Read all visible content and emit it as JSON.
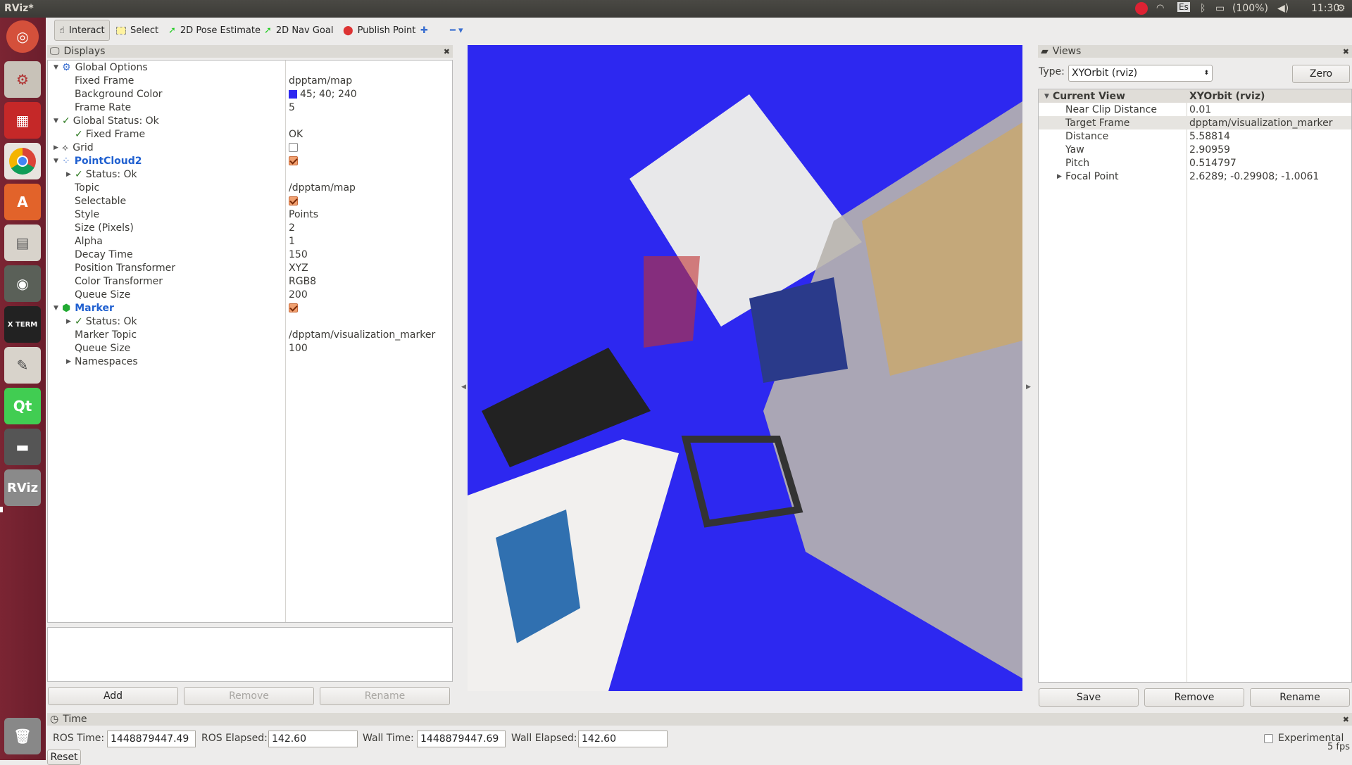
{
  "window_title": "RViz*",
  "top_indicators": {
    "keyboard": "Es",
    "battery": "(100%)",
    "clock": "11:30"
  },
  "colors": {
    "viewport_bg": "#2d28f0",
    "launcher": "#7b2533",
    "accent_blue": "#2060d0",
    "swatch": "#2d28f0"
  },
  "launcher_icons": [
    "ubuntu-dash-icon",
    "settings-icon",
    "app-red-icon",
    "chrome-icon",
    "software-center-icon",
    "files-icon",
    "eye-of-gnome-icon",
    "xterm-icon",
    "text-editor-icon",
    "qt-creator-icon",
    "terminal-icon",
    "rviz-icon",
    "trash-icon"
  ],
  "launcher_labels": {
    "xterm": "X TERM",
    "qt": "Qt",
    "rviz": "RViz"
  },
  "toolbar": {
    "interact": "Interact",
    "select": "Select",
    "pose": "2D Pose Estimate",
    "nav": "2D Nav Goal",
    "publish": "Publish Point"
  },
  "displays": {
    "title": "Displays",
    "rows": [
      {
        "label": "Global Options",
        "value": ""
      },
      {
        "label": "Fixed Frame",
        "value": "dpptam/map"
      },
      {
        "label": "Background Color",
        "value": "45; 40; 240"
      },
      {
        "label": "Frame Rate",
        "value": "5"
      },
      {
        "label": "Global Status: Ok",
        "value": ""
      },
      {
        "label": "Fixed Frame",
        "value": "OK"
      },
      {
        "label": "Grid",
        "value": ""
      },
      {
        "label": "PointCloud2",
        "value": ""
      },
      {
        "label": "Status: Ok",
        "value": ""
      },
      {
        "label": "Topic",
        "value": "/dpptam/map"
      },
      {
        "label": "Selectable",
        "value": ""
      },
      {
        "label": "Style",
        "value": "Points"
      },
      {
        "label": "Size (Pixels)",
        "value": "2"
      },
      {
        "label": "Alpha",
        "value": "1"
      },
      {
        "label": "Decay Time",
        "value": "150"
      },
      {
        "label": "Position Transformer",
        "value": "XYZ"
      },
      {
        "label": "Color Transformer",
        "value": "RGB8"
      },
      {
        "label": "Queue Size",
        "value": "200"
      },
      {
        "label": "Marker",
        "value": ""
      },
      {
        "label": "Status: Ok",
        "value": ""
      },
      {
        "label": "Marker Topic",
        "value": "/dpptam/visualization_marker"
      },
      {
        "label": "Queue Size",
        "value": "100"
      },
      {
        "label": "Namespaces",
        "value": ""
      }
    ],
    "buttons": {
      "add": "Add",
      "remove": "Remove",
      "rename": "Rename"
    }
  },
  "views": {
    "title": "Views",
    "type_label": "Type:",
    "type_value": "XYOrbit (rviz)",
    "zero": "Zero",
    "header": {
      "label": "Current View",
      "value": "XYOrbit (rviz)"
    },
    "rows": [
      {
        "label": "Near Clip Distance",
        "value": "0.01"
      },
      {
        "label": "Target Frame",
        "value": "dpptam/visualization_marker"
      },
      {
        "label": "Distance",
        "value": "5.58814"
      },
      {
        "label": "Yaw",
        "value": "2.90959"
      },
      {
        "label": "Pitch",
        "value": "0.514797"
      },
      {
        "label": "Focal Point",
        "value": "2.6289; -0.29908; -1.0061"
      }
    ],
    "buttons": {
      "save": "Save",
      "remove": "Remove",
      "rename": "Rename"
    }
  },
  "time": {
    "title": "Time",
    "ros_time_label": "ROS Time:",
    "ros_time": "1448879447.49",
    "ros_elapsed_label": "ROS Elapsed:",
    "ros_elapsed": "142.60",
    "wall_time_label": "Wall Time:",
    "wall_time": "1448879447.69",
    "wall_elapsed_label": "Wall Elapsed:",
    "wall_elapsed": "142.60",
    "experimental": "Experimental",
    "reset": "Reset",
    "fps": "5 fps"
  }
}
